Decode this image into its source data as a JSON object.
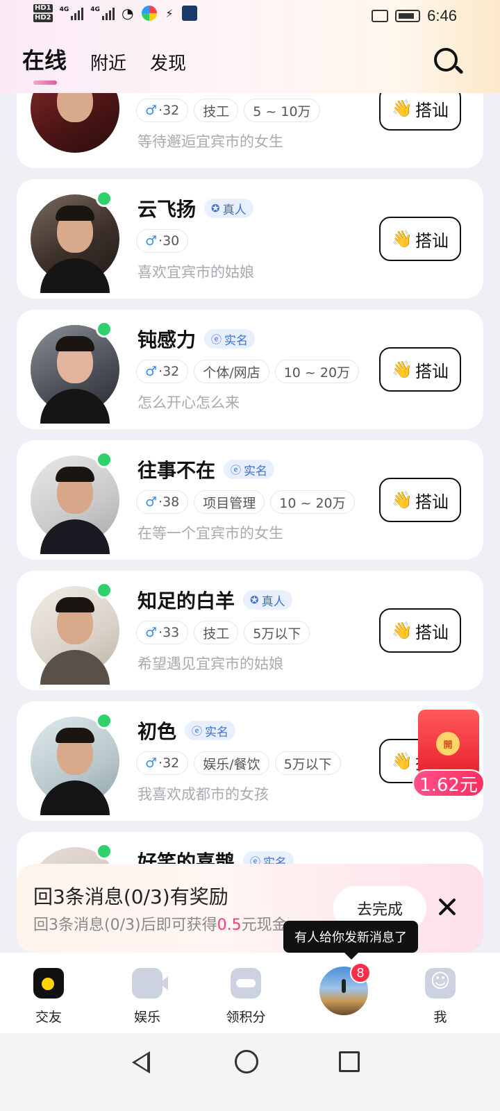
{
  "status_bar": {
    "hd1": "HD1",
    "hd2": "HD2",
    "net1": "4G",
    "net2": "4G",
    "time": "6:46"
  },
  "header": {
    "tabs": [
      {
        "label": "在线",
        "active": true
      },
      {
        "label": "附近",
        "active": false
      },
      {
        "label": "发现",
        "active": false
      }
    ]
  },
  "users": [
    {
      "name": "",
      "verify": "",
      "age": "32",
      "tags": [
        "技工",
        "5 ~ 10万"
      ],
      "bio": "等待邂逅宜宾市的女生",
      "online": false
    },
    {
      "name": "云飞扬",
      "verify": "真人",
      "verify_icon": "shield-icon",
      "age": "30",
      "tags": [],
      "bio": "喜欢宜宾市的姑娘",
      "online": true
    },
    {
      "name": "钝感力",
      "verify": "实名",
      "verify_icon": "id-icon",
      "age": "32",
      "tags": [
        "个体/网店",
        "10 ~ 20万"
      ],
      "bio": "怎么开心怎么来",
      "online": true
    },
    {
      "name": "往事不在",
      "verify": "实名",
      "verify_icon": "id-icon",
      "age": "38",
      "tags": [
        "项目管理",
        "10 ~ 20万"
      ],
      "bio": "在等一个宜宾市的女生",
      "online": true
    },
    {
      "name": "知足的白羊",
      "verify": "真人",
      "verify_icon": "shield-icon",
      "age": "33",
      "tags": [
        "技工",
        "5万以下"
      ],
      "bio": "希望遇见宜宾市的姑娘",
      "online": true
    },
    {
      "name": "初色",
      "verify": "实名",
      "verify_icon": "id-icon",
      "age": "32",
      "tags": [
        "娱乐/餐饮",
        "5万以下"
      ],
      "bio": "我喜欢成都市的女孩",
      "online": true
    },
    {
      "name": "好笑的喜鹊",
      "verify": "实名",
      "verify_icon": "id-icon",
      "age": "",
      "tags": [],
      "bio": "",
      "online": true
    }
  ],
  "greet_label": "搭讪",
  "male_symbol": "♂",
  "red_packet": {
    "char": "開",
    "amount": "1.62元"
  },
  "task_banner": {
    "title": "回3条消息(0/3)有奖励",
    "sub_prefix": "回3条消息(0/3)后即可获得",
    "sub_amount": "0.5",
    "sub_suffix": "元现金",
    "button": "去完成"
  },
  "tooltip": "有人给你发新消息了",
  "bottom_nav": [
    {
      "label": "交友",
      "icon": "home-icon"
    },
    {
      "label": "娱乐",
      "icon": "video-icon"
    },
    {
      "label": "领积分",
      "icon": "gift-icon"
    },
    {
      "label": "",
      "icon": "messages-avatar"
    },
    {
      "label": "我",
      "icon": "smile-icon"
    }
  ],
  "unread_badge": "8",
  "colors": {
    "online": "#2ed16a",
    "accent": "#ff3b78",
    "verify": "#3d6fd6"
  }
}
